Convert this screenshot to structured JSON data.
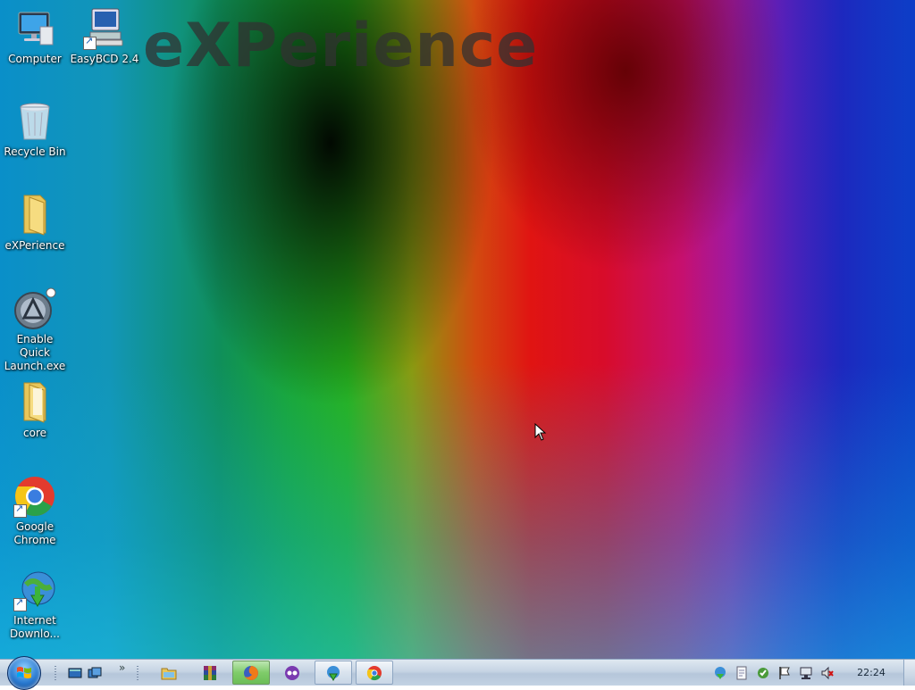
{
  "wallpaper": {
    "text": "eXPerience"
  },
  "desktop_icons": [
    {
      "label": "Computer",
      "icon": "computer-icon",
      "shortcut": false
    },
    {
      "label": "EasyBCD 2.4",
      "icon": "easybcd-icon",
      "shortcut": true
    },
    {
      "label": "Recycle Bin",
      "icon": "recycle-bin-icon",
      "shortcut": false
    },
    {
      "label": "eXPerience",
      "icon": "folder-icon",
      "shortcut": false
    },
    {
      "label": "Enable Quick Launch.exe",
      "icon": "quick-launch-app-icon",
      "shortcut": false
    },
    {
      "label": "core",
      "icon": "folder-icon",
      "shortcut": false
    },
    {
      "label": "Google Chrome",
      "icon": "chrome-icon",
      "shortcut": true
    },
    {
      "label": "Internet Downlo...",
      "icon": "internet-download-manager-icon",
      "shortcut": true
    }
  ],
  "taskbar": {
    "start_button": "windows-start-orb",
    "quick_launch": [
      "show-desktop-icon",
      "switch-windows-icon"
    ],
    "overflow_chevron": "»",
    "buttons": [
      {
        "icon": "windows-explorer-icon",
        "state": "pinned"
      },
      {
        "icon": "winrar-icon",
        "state": "pinned"
      },
      {
        "icon": "firefox-icon",
        "state": "running"
      },
      {
        "icon": "messenger-icon",
        "state": "pinned"
      },
      {
        "icon": "internet-download-manager-icon",
        "state": "active"
      },
      {
        "icon": "chrome-icon",
        "state": "active"
      }
    ],
    "tray": [
      "idm-tray-icon",
      "notes-tray-icon",
      "security-tray-icon",
      "action-center-flag-icon",
      "network-icon",
      "volume-muted-icon"
    ],
    "clock": "22:24"
  }
}
